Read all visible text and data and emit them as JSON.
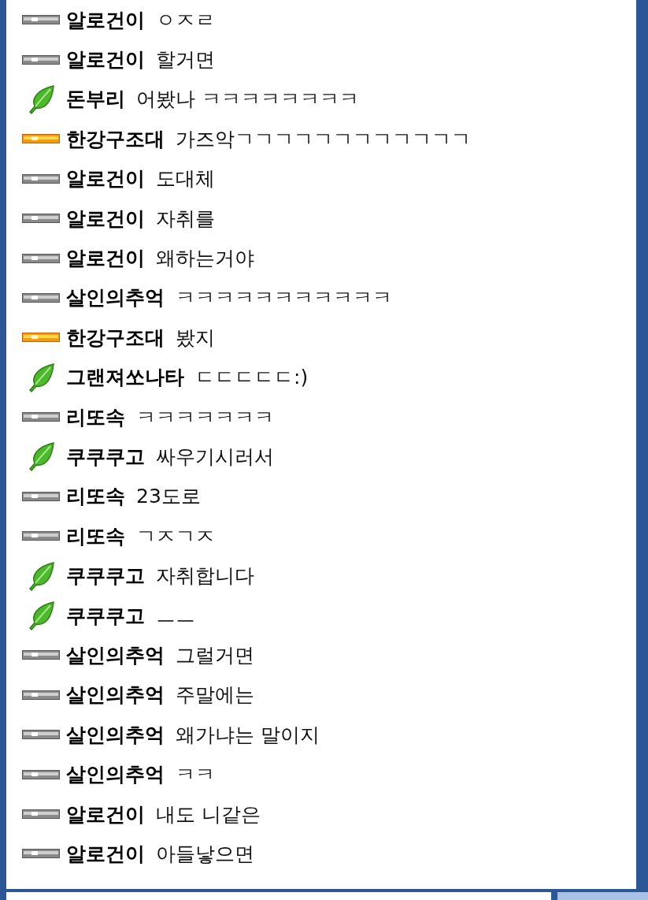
{
  "messages": [
    {
      "kind": "gray",
      "name": "알로건이",
      "text": "ㅇㅈㄹ"
    },
    {
      "kind": "gray",
      "name": "알로건이",
      "text": "할거면"
    },
    {
      "kind": "leaf",
      "name": "돈부리",
      "text": "어봤나 ㅋㅋㅋㅋㅋㅋㅋㅋ"
    },
    {
      "kind": "gold",
      "name": "한강구조대",
      "text": "가즈악ㄱㄱㄱㄱㄱㄱㄱㄱㄱㄱㄱㄱ"
    },
    {
      "kind": "gray",
      "name": "알로건이",
      "text": "도대체"
    },
    {
      "kind": "gray",
      "name": "알로건이",
      "text": "자취를"
    },
    {
      "kind": "gray",
      "name": "알로건이",
      "text": "왜하는거야"
    },
    {
      "kind": "gray",
      "name": "살인의추억",
      "text": "ㅋㅋㅋㅋㅋㅋㅋㅋㅋㅋㅋ"
    },
    {
      "kind": "gold",
      "name": "한강구조대",
      "text": "봤지"
    },
    {
      "kind": "leaf",
      "name": "그랜져쏘나타",
      "text": "ㄷㄷㄷㄷㄷ:)"
    },
    {
      "kind": "gray",
      "name": "리또속",
      "text": "ㅋㅋㅋㅋㅋㅋㅋ"
    },
    {
      "kind": "leaf",
      "name": "쿠쿠쿠고",
      "text": "싸우기시러서"
    },
    {
      "kind": "gray",
      "name": "리또속",
      "text": "23도로"
    },
    {
      "kind": "gray",
      "name": "리또속",
      "text": "ㄱㅈㄱㅈ"
    },
    {
      "kind": "leaf",
      "name": "쿠쿠쿠고",
      "text": "자취합니다"
    },
    {
      "kind": "leaf",
      "name": "쿠쿠쿠고",
      "text": "ㅡㅡ"
    },
    {
      "kind": "gray",
      "name": "살인의추억",
      "text": "그럴거면"
    },
    {
      "kind": "gray",
      "name": "살인의추억",
      "text": "주말에는"
    },
    {
      "kind": "gray",
      "name": "살인의추억",
      "text": "왜가냐는 말이지"
    },
    {
      "kind": "gray",
      "name": "살인의추억",
      "text": "ㅋㅋ"
    },
    {
      "kind": "gray",
      "name": "알로건이",
      "text": "내도 니같은"
    },
    {
      "kind": "gray",
      "name": "알로건이",
      "text": "아들낳으면"
    }
  ]
}
